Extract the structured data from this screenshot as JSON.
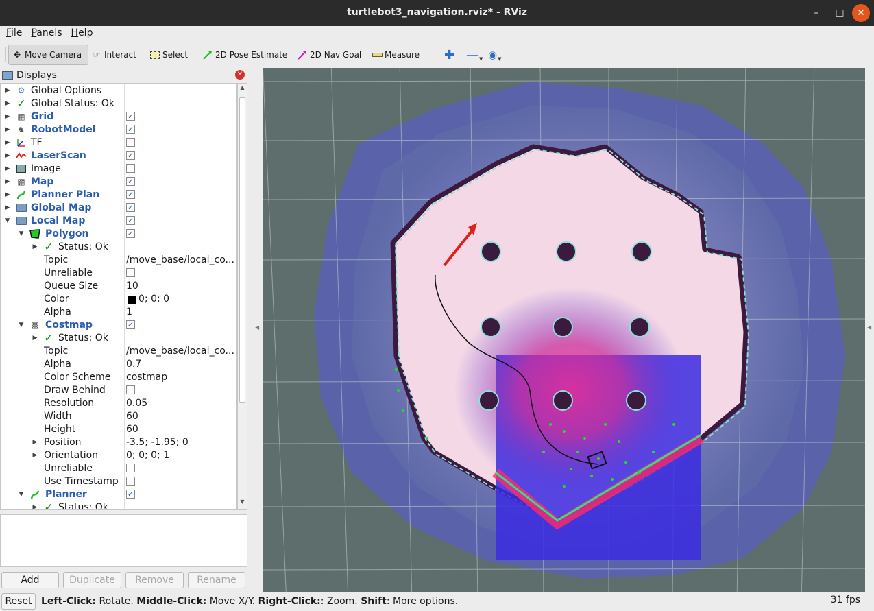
{
  "window": {
    "title": "turtlebot3_navigation.rviz* - RViz"
  },
  "menu": [
    "File",
    "Panels",
    "Help"
  ],
  "toolbar": {
    "tools": [
      "Move Camera",
      "Interact",
      "Select",
      "2D Pose Estimate",
      "2D Nav Goal",
      "Measure"
    ],
    "active": "Move Camera"
  },
  "displays": {
    "title": "Displays",
    "rows": [
      {
        "label": "Global Options",
        "icon": "gear-icon"
      },
      {
        "label": "Global Status: Ok",
        "icon": "check-icon"
      },
      {
        "label": "Grid",
        "icon": "grid-icon",
        "checked": true
      },
      {
        "label": "RobotModel",
        "icon": "robot-icon",
        "checked": true
      },
      {
        "label": "TF",
        "icon": "axes-icon",
        "checked": false
      },
      {
        "label": "LaserScan",
        "icon": "laserscan-icon",
        "checked": true
      },
      {
        "label": "Image",
        "icon": "image-icon",
        "checked": false
      },
      {
        "label": "Map",
        "icon": "map-icon",
        "checked": true
      },
      {
        "label": "Planner Plan",
        "icon": "path-icon",
        "checked": true
      },
      {
        "label": "Global Map",
        "icon": "folder-icon",
        "checked": true
      },
      {
        "label": "Local Map",
        "icon": "folder-icon",
        "checked": true
      },
      {
        "label": "Polygon",
        "icon": "polygon-icon",
        "checked": true
      },
      {
        "label": "Status: Ok",
        "icon": "check-icon"
      },
      {
        "label": "Topic",
        "value": "/move_base/local_co..."
      },
      {
        "label": "Unreliable",
        "checked": false
      },
      {
        "label": "Queue Size",
        "value": "10"
      },
      {
        "label": "Color",
        "value": "0; 0; 0"
      },
      {
        "label": "Alpha",
        "value": "1"
      },
      {
        "label": "Costmap",
        "icon": "map-icon",
        "checked": true
      },
      {
        "label": "Status: Ok",
        "icon": "check-icon"
      },
      {
        "label": "Topic",
        "value": "/move_base/local_co..."
      },
      {
        "label": "Alpha",
        "value": "0.7"
      },
      {
        "label": "Color Scheme",
        "value": "costmap"
      },
      {
        "label": "Draw Behind",
        "checked": false
      },
      {
        "label": "Resolution",
        "value": "0.05"
      },
      {
        "label": "Width",
        "value": "60"
      },
      {
        "label": "Height",
        "value": "60"
      },
      {
        "label": "Position",
        "value": "-3.5; -1.95; 0"
      },
      {
        "label": "Orientation",
        "value": "0; 0; 0; 1"
      },
      {
        "label": "Unreliable",
        "checked": false
      },
      {
        "label": "Use Timestamp",
        "checked": false
      },
      {
        "label": "Planner",
        "icon": "path-icon",
        "checked": true
      },
      {
        "label": "Status: Ok",
        "icon": "check-icon"
      }
    ]
  },
  "buttons": [
    "Add",
    "Duplicate",
    "Remove",
    "Rename"
  ],
  "status": {
    "reset": "Reset",
    "left": "Left-Click:",
    "left_text": " Rotate. ",
    "middle": "Middle-Click:",
    "middle_text": " Move X/Y. ",
    "right": "Right-Click:",
    "right_text": ": Zoom. ",
    "shift": "Shift",
    "shift_text": ": More options.",
    "fps": "31 fps"
  },
  "colors": {
    "accent": "#2a5db0",
    "close": "#e3571e",
    "viewport_bg": "#5e6e6c"
  }
}
